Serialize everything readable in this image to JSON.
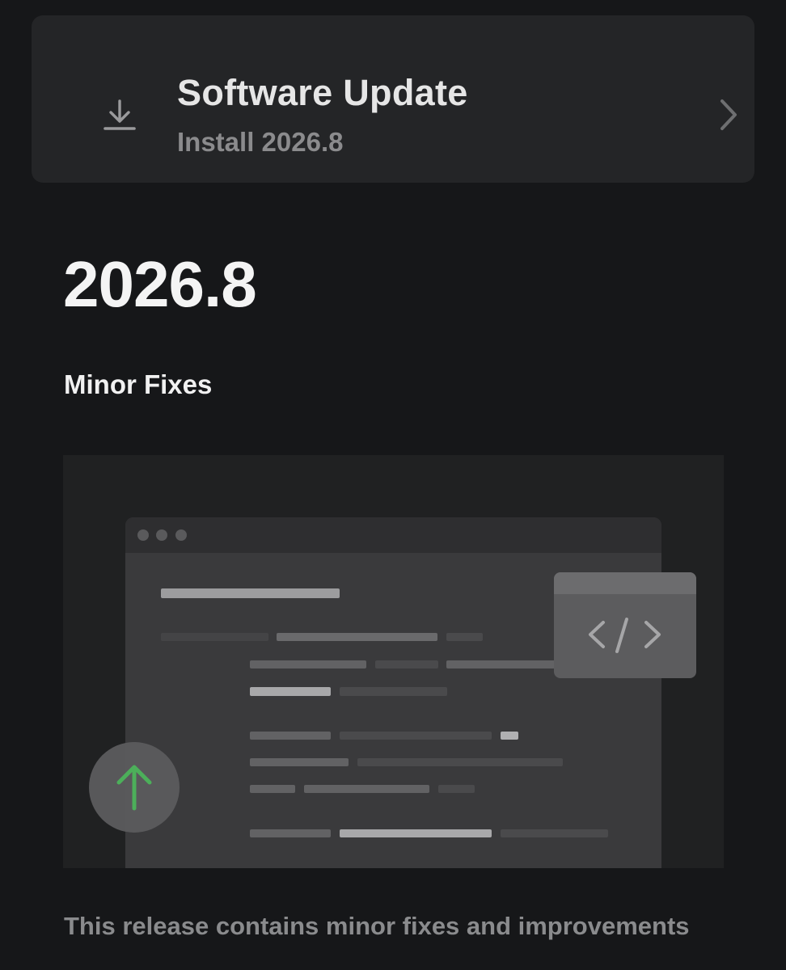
{
  "update_card": {
    "title": "Software Update",
    "subtitle": "Install 2026.8",
    "icon": "download-icon",
    "chevron": "chevron-right-icon"
  },
  "release": {
    "version": "2026.8",
    "heading": "Minor Fixes",
    "description": "This release contains minor fixes and improvements"
  },
  "illustration": {
    "code_icon": "code-icon",
    "update_icon": "arrow-up-icon",
    "accent_color": "#4caf5a"
  },
  "colors": {
    "background": "#161719",
    "card": "#242527",
    "muted_text": "#8a8b8d"
  }
}
